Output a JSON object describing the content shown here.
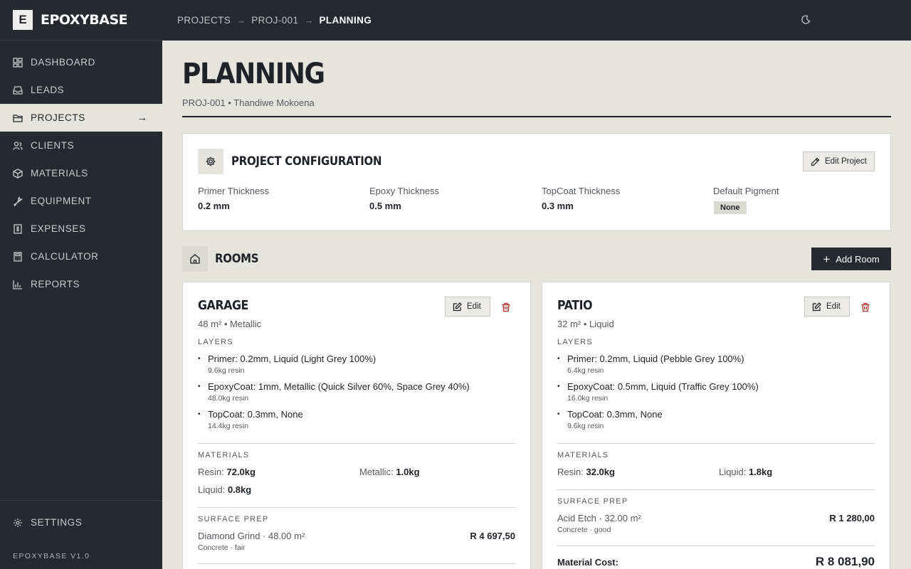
{
  "brand": {
    "mark": "E",
    "name": "EPOXYBASE",
    "version": "EPOXYBASE V1.0"
  },
  "nav": [
    {
      "label": "DASHBOARD",
      "icon": "dashboard-icon"
    },
    {
      "label": "LEADS",
      "icon": "inbox-icon"
    },
    {
      "label": "PROJECTS",
      "icon": "folder-icon",
      "active": true
    },
    {
      "label": "CLIENTS",
      "icon": "users-icon"
    },
    {
      "label": "MATERIALS",
      "icon": "box-icon"
    },
    {
      "label": "EQUIPMENT",
      "icon": "wrench-icon"
    },
    {
      "label": "EXPENSES",
      "icon": "receipt-icon"
    },
    {
      "label": "CALCULATOR",
      "icon": "calculator-icon"
    },
    {
      "label": "REPORTS",
      "icon": "bar-chart-icon"
    }
  ],
  "settings": {
    "label": "SETTINGS"
  },
  "breadcrumb": [
    "PROJECTS",
    "PROJ-001",
    "PLANNING"
  ],
  "breadcrumb_sep": "→",
  "page": {
    "title": "PLANNING",
    "subtitle": "PROJ-001 • Thandiwe Mokoena"
  },
  "config": {
    "title": "PROJECT CONFIGURATION",
    "edit_label": "Edit Project",
    "fields": [
      {
        "label": "Primer Thickness",
        "value": "0.2 mm"
      },
      {
        "label": "Epoxy Thickness",
        "value": "0.5 mm"
      },
      {
        "label": "TopCoat Thickness",
        "value": "0.3 mm"
      },
      {
        "label": "Default Pigment",
        "value": "None"
      }
    ]
  },
  "rooms_section": {
    "title": "ROOMS",
    "add_label": "Add Room"
  },
  "labels": {
    "layers": "LAYERS",
    "materials": "MATERIALS",
    "surface_prep": "SURFACE PREP",
    "edit": "Edit",
    "material_cost": "Material Cost:"
  },
  "rooms": [
    {
      "name": "GARAGE",
      "meta": "48 m² • Metallic",
      "layers": [
        {
          "text": "Primer: 0.2mm, Liquid (Light Grey 100%)",
          "resin": "9.6kg resin"
        },
        {
          "text": "EpoxyCoat: 1mm, Metallic (Quick Silver 60%, Space Grey 40%)",
          "resin": "48.0kg resin"
        },
        {
          "text": "TopCoat: 0.3mm, None",
          "resin": "14.4kg resin"
        }
      ],
      "materials": [
        {
          "label": "Resin:",
          "value": "72.0kg"
        },
        {
          "label": "Metallic:",
          "value": "1.0kg"
        },
        {
          "label": "Liquid:",
          "value": "0.8kg"
        }
      ],
      "prep": {
        "name": "Diamond Grind · 48.00 m²",
        "sub": "Concrete · fair",
        "cost": "R 4 697,50"
      }
    },
    {
      "name": "PATIO",
      "meta": "32 m² • Liquid",
      "layers": [
        {
          "text": "Primer: 0.2mm, Liquid (Pebble Grey 100%)",
          "resin": "6.4kg resin"
        },
        {
          "text": "EpoxyCoat: 0.5mm, Liquid (Traffic Grey 100%)",
          "resin": "16.0kg resin"
        },
        {
          "text": "TopCoat: 0.3mm, None",
          "resin": "9.6kg resin"
        }
      ],
      "materials": [
        {
          "label": "Resin:",
          "value": "32.0kg"
        },
        {
          "label": "Liquid:",
          "value": "1.8kg"
        }
      ],
      "prep": {
        "name": "Acid Etch · 32.00 m²",
        "sub": "Concrete · good",
        "cost": "R 1 280,00"
      },
      "material_cost": "R 8 081,90"
    }
  ],
  "colors": {
    "sidebar": "#262a2f",
    "background": "#e6e4df",
    "danger": "#b42b22"
  }
}
